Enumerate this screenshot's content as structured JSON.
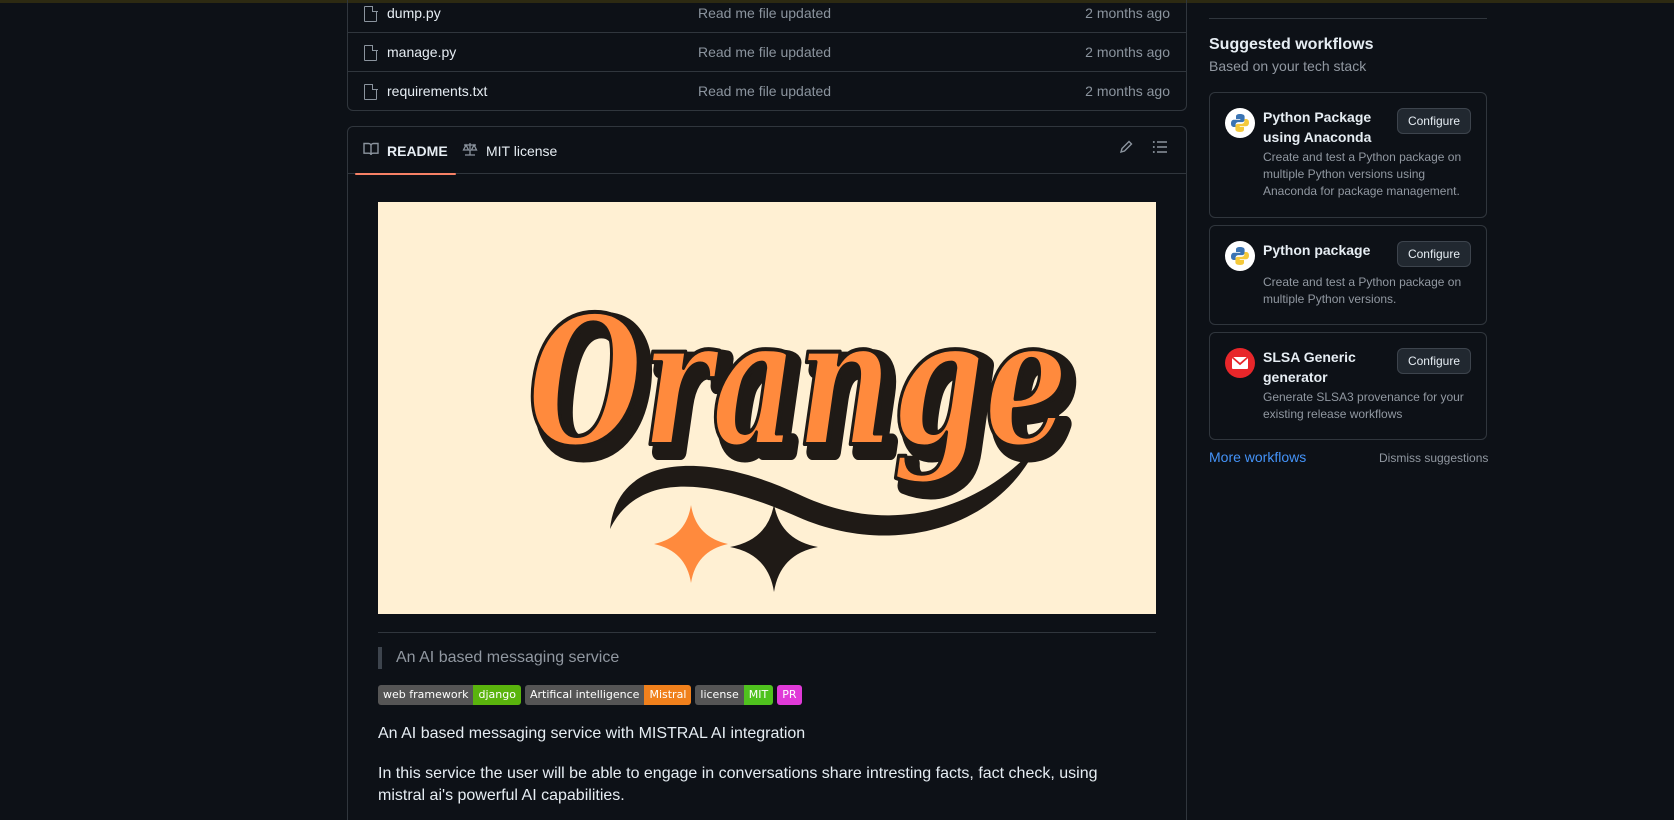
{
  "files": [
    {
      "name": "dump.py",
      "message": "Read me file updated",
      "date": "2 months ago"
    },
    {
      "name": "manage.py",
      "message": "Read me file updated",
      "date": "2 months ago"
    },
    {
      "name": "requirements.txt",
      "message": "Read me file updated",
      "date": "2 months ago"
    }
  ],
  "readme": {
    "tabs": [
      {
        "label": "README",
        "icon": "book-icon",
        "active": true
      },
      {
        "label": "MIT license",
        "icon": "scale-icon",
        "active": false
      }
    ],
    "actions": [
      "pencil-icon",
      "list-icon"
    ],
    "banner": {
      "word": "Orange",
      "bg": "#fff0d3",
      "orange": "#ff8a3d",
      "dark": "#1f1a16"
    },
    "quote": "An AI based messaging service",
    "badges": [
      {
        "label": "web framework",
        "value": "django",
        "color": "#5ab40d"
      },
      {
        "label": "Artifical intelligence",
        "value": "Mistral",
        "color": "#f0801c"
      },
      {
        "label": "license",
        "value": "MIT",
        "color": "#4fc21e"
      },
      {
        "label": "",
        "value": "PR",
        "color": "#e03ad8"
      }
    ],
    "para1": "An AI based messaging service with MISTRAL AI integration",
    "para2": "In this service the user will be able to engage in conversations share intresting facts, fact check, using mistral ai's powerful AI capabilities."
  },
  "sidebar": {
    "title": "Suggested workflows",
    "subtitle": "Based on your tech stack",
    "workflows": [
      {
        "title": "Python Package using Anaconda",
        "desc": "Create and test a Python package on multiple Python versions using Anaconda for package management.",
        "button": "Configure",
        "icon": "python-icon"
      },
      {
        "title": "Python package",
        "desc": "Create and test a Python package on multiple Python versions.",
        "button": "Configure",
        "icon": "python-icon"
      },
      {
        "title": "SLSA Generic generator",
        "desc": "Generate SLSA3 provenance for your existing release workflows",
        "button": "Configure",
        "icon": "slsa-icon"
      }
    ],
    "more": "More workflows",
    "dismiss": "Dismiss suggestions"
  }
}
